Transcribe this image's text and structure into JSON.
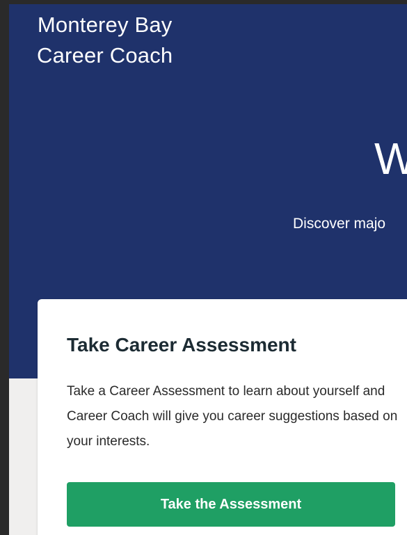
{
  "brand": {
    "line1": "Monterey Bay",
    "line2": "Career Coach"
  },
  "hero": {
    "title_visible": "W",
    "subtitle_visible": "Discover majo"
  },
  "card": {
    "title": "Take Career Assessment",
    "description": "Take a Career Assessment to learn about yourself and Career Coach will give you career suggestions based on your interests.",
    "button_label": "Take the Assessment"
  },
  "colors": {
    "hero_background": "#1f326b",
    "page_background": "#f0efee",
    "button_background": "#1f9f64",
    "card_title_text": "#1c2b33"
  }
}
